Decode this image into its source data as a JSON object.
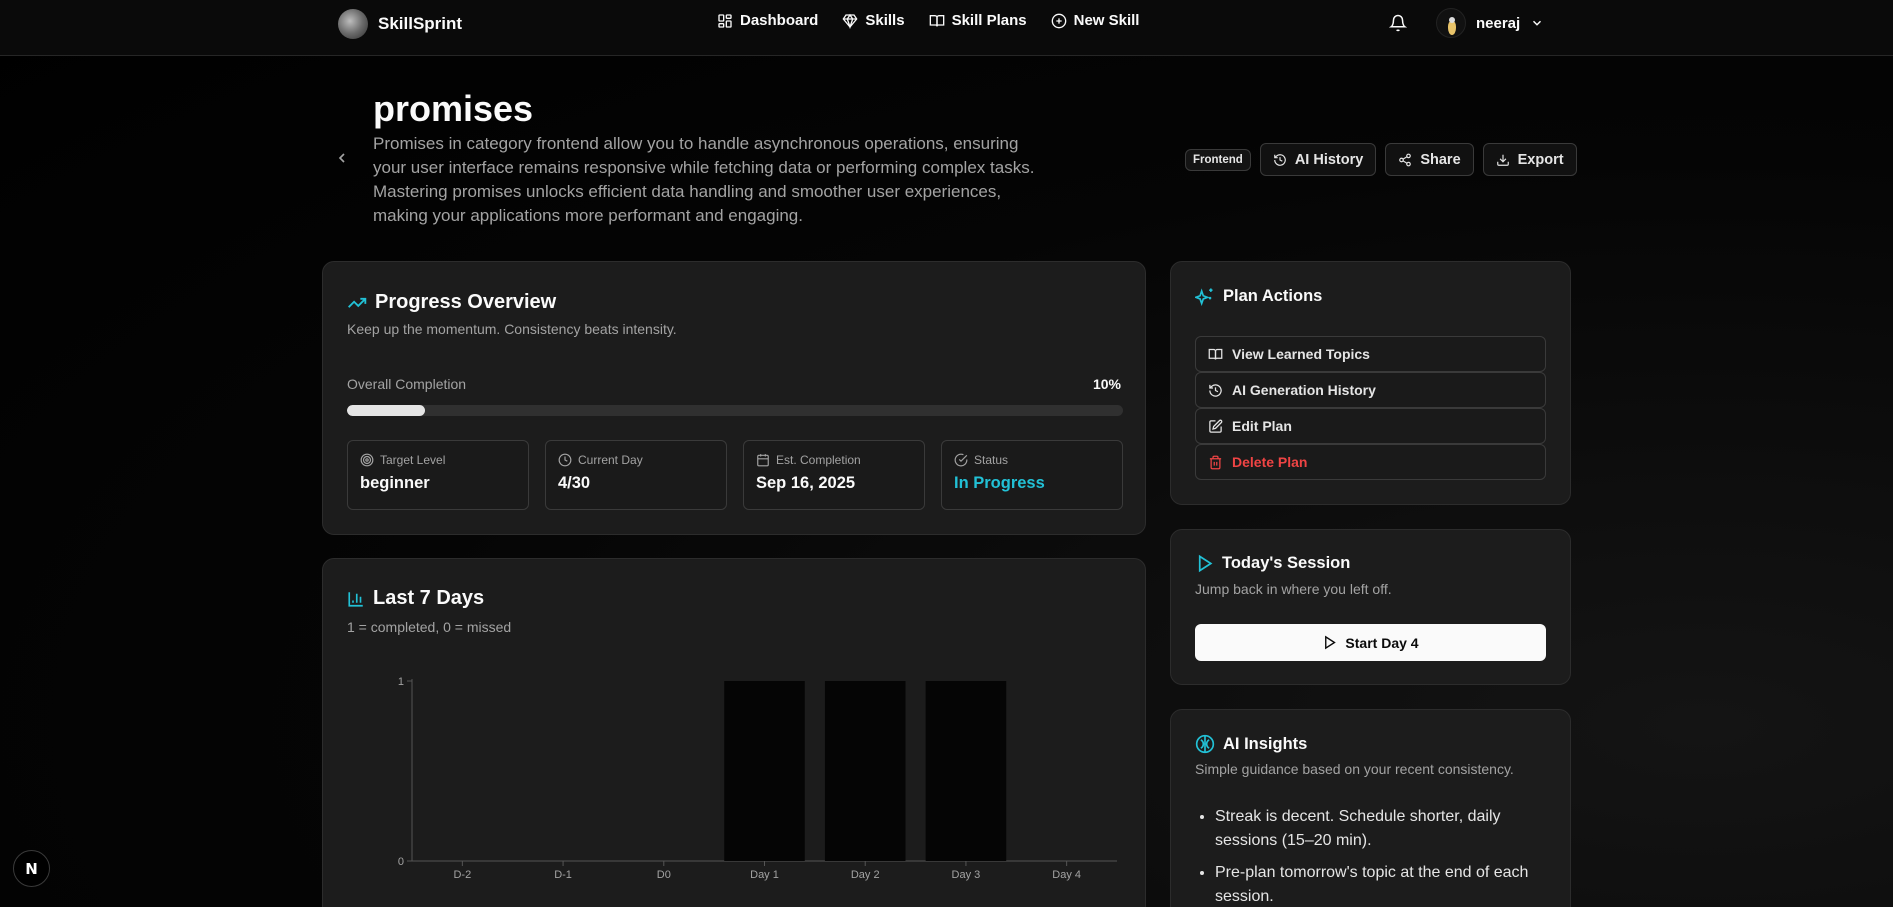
{
  "colors": {
    "accent": "#22c1d6",
    "danger": "#ef4444",
    "bar": "#050505"
  },
  "brand": {
    "name": "SkillSprint"
  },
  "nav": [
    {
      "label": "Dashboard",
      "icon": "grid-icon"
    },
    {
      "label": "Skills",
      "icon": "gem-icon"
    },
    {
      "label": "Skill Plans",
      "icon": "book-icon"
    },
    {
      "label": "New Skill",
      "icon": "plus-circle-icon"
    }
  ],
  "user": {
    "name": "neeraj"
  },
  "header": {
    "title": "promises",
    "description": "Promises in category frontend allow you to handle asynchronous operations, ensuring your user interface remains responsive while fetching data or performing complex tasks. Mastering promises unlocks efficient data handling and smoother user experiences, making your applications more performant and engaging.",
    "category_badge": "Frontend",
    "ai_history_label": "AI History",
    "share_label": "Share",
    "export_label": "Export"
  },
  "progress": {
    "title": "Progress Overview",
    "subtitle": "Keep up the momentum. Consistency beats intensity.",
    "completion_label": "Overall Completion",
    "completion_text": "10%",
    "completion_fraction": 0.1,
    "stats": [
      {
        "label": "Target Level",
        "value": "beginner",
        "icon": "target-icon"
      },
      {
        "label": "Current Day",
        "value": "4/30",
        "icon": "clock-icon"
      },
      {
        "label": "Est. Completion",
        "value": "Sep 16, 2025",
        "icon": "calendar-icon"
      },
      {
        "label": "Status",
        "value": "In Progress",
        "icon": "check-circle-icon"
      }
    ]
  },
  "last7": {
    "title": "Last 7 Days",
    "subtitle": "1 = completed, 0 = missed"
  },
  "chart_data": {
    "type": "bar",
    "categories": [
      "D-2",
      "D-1",
      "D0",
      "Day 1",
      "Day 2",
      "Day 3",
      "Day 4"
    ],
    "values": [
      0,
      0,
      0,
      1,
      1,
      1,
      0
    ],
    "ylim": [
      0,
      1
    ],
    "yticks": [
      0,
      1
    ],
    "grid": false,
    "legend": "none"
  },
  "plan_actions": {
    "title": "Plan Actions",
    "items": [
      {
        "label": "View Learned Topics",
        "icon": "book-open-icon",
        "danger": false
      },
      {
        "label": "AI Generation History",
        "icon": "history-icon",
        "danger": false
      },
      {
        "label": "Edit Plan",
        "icon": "edit-icon",
        "danger": false
      },
      {
        "label": "Delete Plan",
        "icon": "trash-icon",
        "danger": true
      }
    ]
  },
  "session": {
    "title": "Today's Session",
    "subtitle": "Jump back in where you left off.",
    "button_label": "Start Day 4"
  },
  "insights": {
    "title": "AI Insights",
    "subtitle": "Simple guidance based on your recent consistency.",
    "items": [
      "Streak is decent. Schedule shorter, daily sessions (15–20 min).",
      "Pre-plan tomorrow's topic at the end of each session."
    ]
  },
  "dev_badge": {
    "label": "N"
  }
}
